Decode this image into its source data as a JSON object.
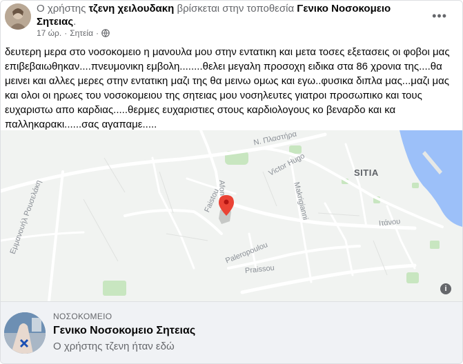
{
  "header": {
    "prefix": "Ο χρήστης",
    "author": "τζενη χειλουδακη",
    "middle": "βρίσκεται στην τοποθεσία",
    "place": "Γενικο Νοσοκομειο Σητειας",
    "suffix": "."
  },
  "meta": {
    "time": "17 ώρ.",
    "separator": "·",
    "location": "Σητεία",
    "audience_icon": "globe-icon"
  },
  "more_icon": "more-options-icon",
  "post_text": "δευτερη μερα στο νοσοκομειο η μανουλα μου στην εντατικη και μετα τοσες εξετασεις οι φοβοι μας επιβεβαιωθηκαν....πνευμονικη εμβολη........θελει μεγαλη προσοχη ειδικα στα 86 χρονια της....θα μεινει και αλλες μερες στην εντατικη  μαζι της  θα μεινω  ομως και  εγω..φυσικα διπλα μας...μαζι μας  και ολοι οι ηρωες του νοσοκομειου  της σητειας μου νοσηλευτες γιατροι προσωπικο και τους ευχαριστω απο καρδιας.....θερμες ευχαριστιες στους καρδιολογους κο βεναρδο  και κα παλληκαρακι......σας αγαπαμε.....",
  "map": {
    "city": "SITIA",
    "streets": [
      "Ν. Πλαστήρα",
      "Victor Hugo",
      "Afon",
      "Makrigianni",
      "Faistou",
      "Ιτάνου",
      "Paleropoulou",
      "Praissou",
      "Εμμανουήλ Ρουσελάκη"
    ],
    "info_icon": "info-icon",
    "pin_icon": "map-pin-icon"
  },
  "footer": {
    "category": "ΝΟΣΟΚΟΜΕΙΟ",
    "place_name": "Γενικο Νοσοκομειο Σητειας",
    "subtitle": "Ο χρήστης τζενη ήταν εδώ"
  },
  "colors": {
    "sea": "#9cc0f9",
    "park": "#c8e6c0",
    "road": "#ffffff",
    "pin": "#ea4335",
    "footer_bg": "#f0f2f5"
  }
}
